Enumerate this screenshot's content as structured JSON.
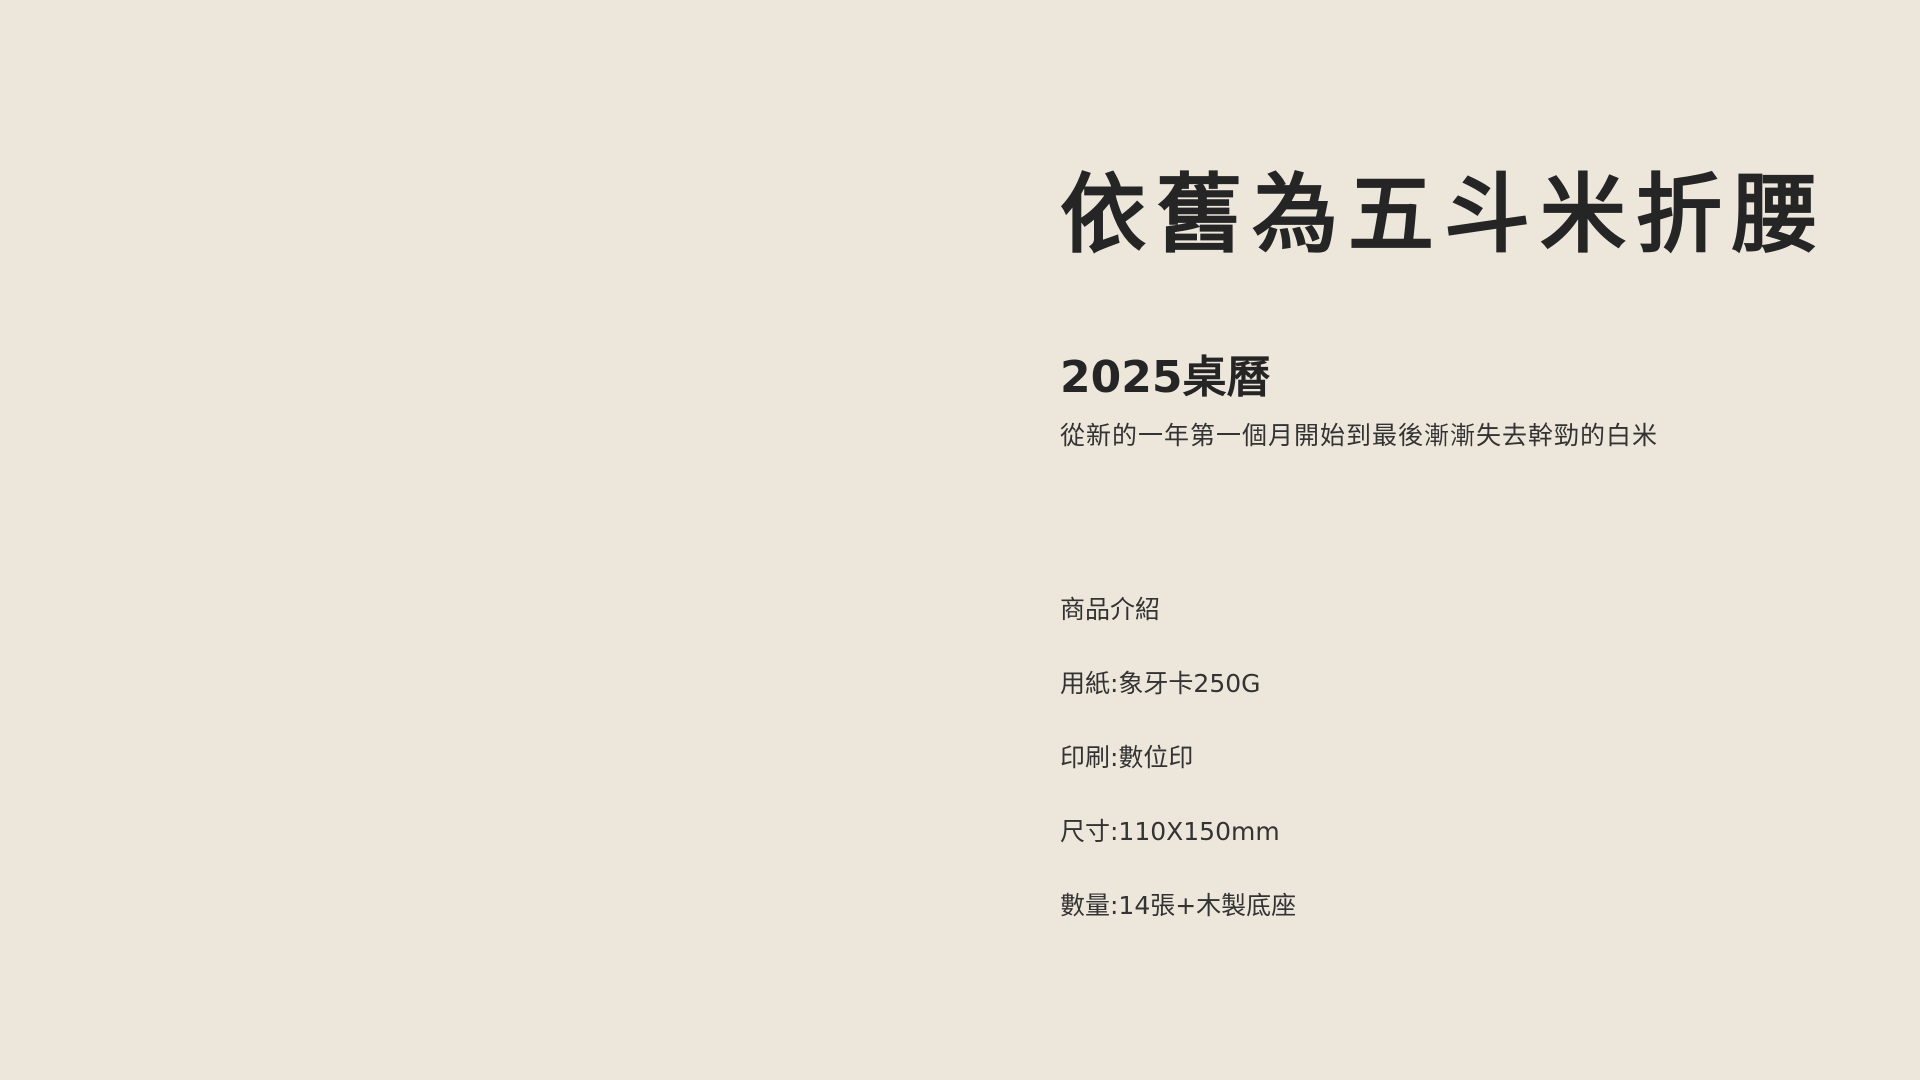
{
  "page": {
    "background_color": "#ede6db",
    "text_color": "#2a2a2a"
  },
  "hero": {
    "title": "依舊為五斗米折腰",
    "subtitle": "2025桌曆",
    "tagline": "從新的一年第一個月開始到最後漸漸失去幹勁的白米"
  },
  "specs": {
    "heading": "商品介紹",
    "items": [
      "用紙:象牙卡250G",
      "印刷:數位印",
      "尺寸:110X150mm",
      "數量:14張+木製底座"
    ]
  }
}
